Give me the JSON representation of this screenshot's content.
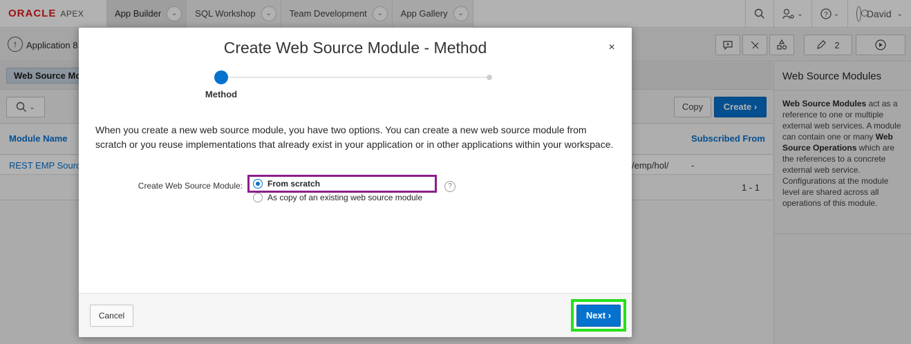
{
  "topbar": {
    "brand": "ORACLE",
    "product": "APEX",
    "tabs": [
      {
        "label": "App Builder"
      },
      {
        "label": "SQL Workshop"
      },
      {
        "label": "Team Development"
      },
      {
        "label": "App Gallery"
      }
    ],
    "user": "David"
  },
  "toolbar": {
    "app_label": "Application 8",
    "edit_count": "2"
  },
  "breadcrumb": {
    "current": "Web Source Mo"
  },
  "report": {
    "copy_label": "Copy",
    "create_label": "Create",
    "columns": {
      "module_name": "Module Name",
      "subscribed_from": "Subscribed From"
    },
    "row": {
      "module_name": "REST EMP Source",
      "url_fragment": "/emp/hol/",
      "subscribed_from": "-"
    },
    "pagination": "1 - 1"
  },
  "side_panel": {
    "title": "Web Source Modules",
    "text_part1": "Web Source Modules",
    "text_part2": " act as a reference to one or multiple external web services. A module can contain one or many ",
    "text_part3": "Web Source Operations",
    "text_part4": " which are the references to a concrete external web service. Configurations at the module level are shared across all operations of this module."
  },
  "dialog": {
    "title": "Create Web Source Module - Method",
    "close_glyph": "×",
    "wizard_step_label": "Method",
    "description": "When you create a new web source module, you have two options. You can create a new web source module from scratch or you reuse implementations that already exist in your application or in other applications within your workspace.",
    "field_label": "Create Web Source Module:",
    "options": [
      {
        "label": "From scratch",
        "selected": true
      },
      {
        "label": "As copy of an existing web source module",
        "selected": false
      }
    ],
    "help_glyph": "?",
    "cancel_label": "Cancel",
    "next_label": "Next"
  },
  "colors": {
    "accent": "#0572ce",
    "brand_red": "#e11b22",
    "highlight_purple": "#8a1f8a",
    "highlight_green": "#25e01b"
  }
}
